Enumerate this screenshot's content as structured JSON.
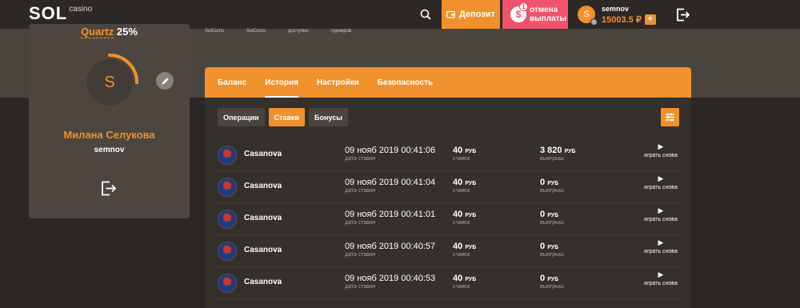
{
  "header": {
    "logo_main": "SOL",
    "logo_sub": "casino",
    "deposit_label": "Депозит",
    "cancel_label": "отмена выплаты",
    "cancel_badge": "1",
    "user": {
      "avatar_letter": "S",
      "login": "semnov",
      "balance": "15003.5 ₽",
      "plus": "+"
    }
  },
  "stats": [
    "SolCoins",
    "SolCoins",
    "доступно",
    "турниров"
  ],
  "profile": {
    "level_name": "Quartz",
    "level_percent": "25%",
    "level_progress": 0.25,
    "avatar_letter": "S",
    "full_name": "Милана Селукова",
    "login": "semnov"
  },
  "tabs": [
    "Баланс",
    "История",
    "Настройки",
    "Безопасность"
  ],
  "active_tab": "История",
  "subtabs": [
    "Операции",
    "Ставки",
    "Бонусы"
  ],
  "active_subtab": "Ставки",
  "bets": [
    {
      "game": "Casanova",
      "date": "09 нояб 2019 00:41:06",
      "date_label": "дата ставки",
      "bet": "40",
      "bet_currency": "РУБ",
      "bet_label": "ставка",
      "win": "3 820",
      "win_currency": "РУБ",
      "win_label": "выигрыш",
      "replay_label": "играть снова"
    },
    {
      "game": "Casanova",
      "date": "09 нояб 2019 00:41:04",
      "date_label": "дата ставки",
      "bet": "40",
      "bet_currency": "РУБ",
      "bet_label": "ставка",
      "win": "0",
      "win_currency": "РУБ",
      "win_label": "выигрыш",
      "replay_label": "играть снова"
    },
    {
      "game": "Casanova",
      "date": "09 нояб 2019 00:41:01",
      "date_label": "дата ставки",
      "bet": "40",
      "bet_currency": "РУБ",
      "bet_label": "ставка",
      "win": "0",
      "win_currency": "РУБ",
      "win_label": "выигрыш",
      "replay_label": "играть снова"
    },
    {
      "game": "Casanova",
      "date": "09 нояб 2019 00:40:57",
      "date_label": "дата ставки",
      "bet": "40",
      "bet_currency": "РУБ",
      "bet_label": "ставка",
      "win": "0",
      "win_currency": "РУБ",
      "win_label": "выигрыш",
      "replay_label": "играть снова"
    },
    {
      "game": "Casanova",
      "date": "09 нояб 2019 00:40:53",
      "date_label": "дата ставки",
      "bet": "40",
      "bet_currency": "РУБ",
      "bet_label": "ставка",
      "win": "0",
      "win_currency": "РУБ",
      "win_label": "выигрыш",
      "replay_label": "играть снова"
    }
  ],
  "colors": {
    "accent": "#f0912d",
    "cancel": "#f0536d",
    "background": "#2a2623",
    "card": "#4d4640"
  }
}
